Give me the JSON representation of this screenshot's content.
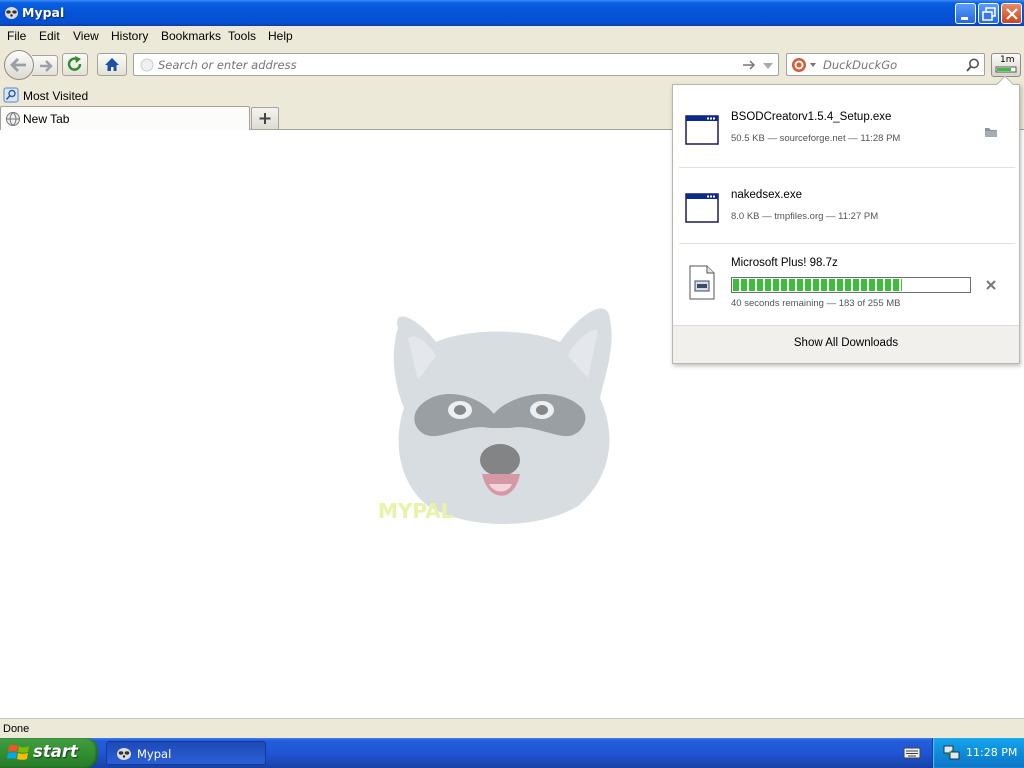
{
  "window": {
    "title": "Mypal"
  },
  "menu": {
    "items": [
      "File",
      "Edit",
      "View",
      "History",
      "Bookmarks",
      "Tools",
      "Help"
    ]
  },
  "navbar": {
    "url_placeholder": "Search or enter address",
    "search_placeholder": "DuckDuckGo",
    "download_button_label": "1m"
  },
  "bookmarks": {
    "items": [
      {
        "label": "Most Visited"
      }
    ]
  },
  "tabs": [
    {
      "label": "New Tab"
    }
  ],
  "content": {
    "logo_text": "MYPAL"
  },
  "status": {
    "text": "Done"
  },
  "downloads": {
    "entries": [
      {
        "filename": "BSODCreatorv1.5.4_Setup.exe",
        "meta": "50.5 KB — sourceforge.net — 11:28 PM",
        "state": "completed",
        "icon": "exe-window-icon"
      },
      {
        "filename": "nakedsex.exe",
        "meta": "8.0 KB — tmpfiles.org — 11:27 PM",
        "state": "completed",
        "icon": "exe-window-icon"
      },
      {
        "filename": "Microsoft Plus! 98.7z",
        "meta": "40 seconds remaining — 183 of 255 MB",
        "state": "in-progress",
        "progress": 0.717,
        "icon": "archive-file-icon"
      }
    ],
    "show_all_label": "Show All Downloads"
  },
  "taskbar": {
    "start_label": "start",
    "task_items": [
      {
        "label": "Mypal"
      }
    ],
    "clock": "11:28 PM"
  },
  "colors": {
    "titlebar": "#0553d8",
    "taskbar": "#245edb",
    "start_button": "#3c9a3c",
    "progress_fill": "#3cbe3c",
    "tray": "#0d8cd9"
  }
}
